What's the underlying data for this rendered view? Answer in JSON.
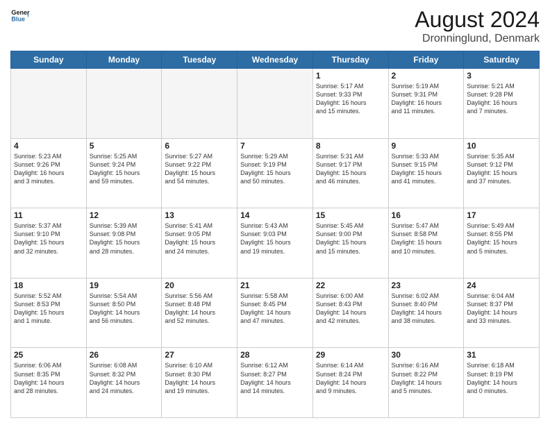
{
  "logo": {
    "line1": "General",
    "line2": "Blue"
  },
  "title": "August 2024",
  "subtitle": "Dronninglund, Denmark",
  "days_of_week": [
    "Sunday",
    "Monday",
    "Tuesday",
    "Wednesday",
    "Thursday",
    "Friday",
    "Saturday"
  ],
  "weeks": [
    [
      {
        "day": "",
        "info": "",
        "empty": true
      },
      {
        "day": "",
        "info": "",
        "empty": true
      },
      {
        "day": "",
        "info": "",
        "empty": true
      },
      {
        "day": "",
        "info": "",
        "empty": true
      },
      {
        "day": "1",
        "info": "Sunrise: 5:17 AM\nSunset: 9:33 PM\nDaylight: 16 hours\nand 15 minutes.",
        "empty": false
      },
      {
        "day": "2",
        "info": "Sunrise: 5:19 AM\nSunset: 9:31 PM\nDaylight: 16 hours\nand 11 minutes.",
        "empty": false
      },
      {
        "day": "3",
        "info": "Sunrise: 5:21 AM\nSunset: 9:28 PM\nDaylight: 16 hours\nand 7 minutes.",
        "empty": false
      }
    ],
    [
      {
        "day": "4",
        "info": "Sunrise: 5:23 AM\nSunset: 9:26 PM\nDaylight: 16 hours\nand 3 minutes.",
        "empty": false
      },
      {
        "day": "5",
        "info": "Sunrise: 5:25 AM\nSunset: 9:24 PM\nDaylight: 15 hours\nand 59 minutes.",
        "empty": false
      },
      {
        "day": "6",
        "info": "Sunrise: 5:27 AM\nSunset: 9:22 PM\nDaylight: 15 hours\nand 54 minutes.",
        "empty": false
      },
      {
        "day": "7",
        "info": "Sunrise: 5:29 AM\nSunset: 9:19 PM\nDaylight: 15 hours\nand 50 minutes.",
        "empty": false
      },
      {
        "day": "8",
        "info": "Sunrise: 5:31 AM\nSunset: 9:17 PM\nDaylight: 15 hours\nand 46 minutes.",
        "empty": false
      },
      {
        "day": "9",
        "info": "Sunrise: 5:33 AM\nSunset: 9:15 PM\nDaylight: 15 hours\nand 41 minutes.",
        "empty": false
      },
      {
        "day": "10",
        "info": "Sunrise: 5:35 AM\nSunset: 9:12 PM\nDaylight: 15 hours\nand 37 minutes.",
        "empty": false
      }
    ],
    [
      {
        "day": "11",
        "info": "Sunrise: 5:37 AM\nSunset: 9:10 PM\nDaylight: 15 hours\nand 32 minutes.",
        "empty": false
      },
      {
        "day": "12",
        "info": "Sunrise: 5:39 AM\nSunset: 9:08 PM\nDaylight: 15 hours\nand 28 minutes.",
        "empty": false
      },
      {
        "day": "13",
        "info": "Sunrise: 5:41 AM\nSunset: 9:05 PM\nDaylight: 15 hours\nand 24 minutes.",
        "empty": false
      },
      {
        "day": "14",
        "info": "Sunrise: 5:43 AM\nSunset: 9:03 PM\nDaylight: 15 hours\nand 19 minutes.",
        "empty": false
      },
      {
        "day": "15",
        "info": "Sunrise: 5:45 AM\nSunset: 9:00 PM\nDaylight: 15 hours\nand 15 minutes.",
        "empty": false
      },
      {
        "day": "16",
        "info": "Sunrise: 5:47 AM\nSunset: 8:58 PM\nDaylight: 15 hours\nand 10 minutes.",
        "empty": false
      },
      {
        "day": "17",
        "info": "Sunrise: 5:49 AM\nSunset: 8:55 PM\nDaylight: 15 hours\nand 5 minutes.",
        "empty": false
      }
    ],
    [
      {
        "day": "18",
        "info": "Sunrise: 5:52 AM\nSunset: 8:53 PM\nDaylight: 15 hours\nand 1 minute.",
        "empty": false
      },
      {
        "day": "19",
        "info": "Sunrise: 5:54 AM\nSunset: 8:50 PM\nDaylight: 14 hours\nand 56 minutes.",
        "empty": false
      },
      {
        "day": "20",
        "info": "Sunrise: 5:56 AM\nSunset: 8:48 PM\nDaylight: 14 hours\nand 52 minutes.",
        "empty": false
      },
      {
        "day": "21",
        "info": "Sunrise: 5:58 AM\nSunset: 8:45 PM\nDaylight: 14 hours\nand 47 minutes.",
        "empty": false
      },
      {
        "day": "22",
        "info": "Sunrise: 6:00 AM\nSunset: 8:43 PM\nDaylight: 14 hours\nand 42 minutes.",
        "empty": false
      },
      {
        "day": "23",
        "info": "Sunrise: 6:02 AM\nSunset: 8:40 PM\nDaylight: 14 hours\nand 38 minutes.",
        "empty": false
      },
      {
        "day": "24",
        "info": "Sunrise: 6:04 AM\nSunset: 8:37 PM\nDaylight: 14 hours\nand 33 minutes.",
        "empty": false
      }
    ],
    [
      {
        "day": "25",
        "info": "Sunrise: 6:06 AM\nSunset: 8:35 PM\nDaylight: 14 hours\nand 28 minutes.",
        "empty": false
      },
      {
        "day": "26",
        "info": "Sunrise: 6:08 AM\nSunset: 8:32 PM\nDaylight: 14 hours\nand 24 minutes.",
        "empty": false
      },
      {
        "day": "27",
        "info": "Sunrise: 6:10 AM\nSunset: 8:30 PM\nDaylight: 14 hours\nand 19 minutes.",
        "empty": false
      },
      {
        "day": "28",
        "info": "Sunrise: 6:12 AM\nSunset: 8:27 PM\nDaylight: 14 hours\nand 14 minutes.",
        "empty": false
      },
      {
        "day": "29",
        "info": "Sunrise: 6:14 AM\nSunset: 8:24 PM\nDaylight: 14 hours\nand 9 minutes.",
        "empty": false
      },
      {
        "day": "30",
        "info": "Sunrise: 6:16 AM\nSunset: 8:22 PM\nDaylight: 14 hours\nand 5 minutes.",
        "empty": false
      },
      {
        "day": "31",
        "info": "Sunrise: 6:18 AM\nSunset: 8:19 PM\nDaylight: 14 hours\nand 0 minutes.",
        "empty": false
      }
    ]
  ]
}
